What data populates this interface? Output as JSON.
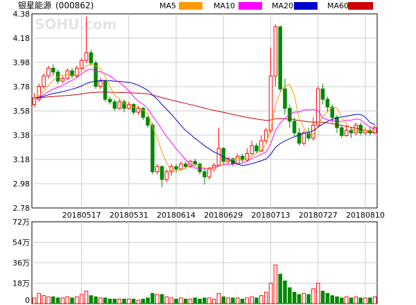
{
  "header": {
    "title": "银星能源",
    "code": "(000862)"
  },
  "legend": [
    {
      "label": "MA5",
      "color": "#ff9900"
    },
    {
      "label": "MA10",
      "color": "#ff00ff"
    },
    {
      "label": "MA20",
      "color": "#0000cc"
    },
    {
      "label": "MA60",
      "color": "#cc0000"
    }
  ],
  "watermark": "SOHU.com",
  "colors": {
    "up": "#ff0000",
    "down": "#008800",
    "grid": "#cccccc",
    "axis": "#000000",
    "text": "#000000"
  },
  "chart_data": [
    {
      "type": "candlestick",
      "title": "",
      "ylim": [
        2.78,
        4.28
      ],
      "y_ticks": [
        "4.38",
        "4.18",
        "3.98",
        "3.78",
        "3.58",
        "3.38",
        "3.18",
        "2.98",
        "2.78"
      ],
      "x_ticks": [
        {
          "label": "20180517",
          "index": 10
        },
        {
          "label": "20180531",
          "index": 20
        },
        {
          "label": "20180614",
          "index": 30
        },
        {
          "label": "20180629",
          "index": 40
        },
        {
          "label": "20180713",
          "index": 50
        },
        {
          "label": "20180727",
          "index": 60
        },
        {
          "label": "20180810",
          "index": 70
        }
      ],
      "candles": [
        [
          3.58,
          3.63,
          3.67,
          3.56
        ],
        [
          3.62,
          3.72,
          3.74,
          3.6
        ],
        [
          3.72,
          3.8,
          3.82,
          3.7
        ],
        [
          3.8,
          3.86,
          3.88,
          3.78
        ],
        [
          3.86,
          3.83,
          3.89,
          3.8
        ],
        [
          3.83,
          3.76,
          3.85,
          3.74
        ],
        [
          3.76,
          3.78,
          3.8,
          3.74
        ],
        [
          3.78,
          3.84,
          3.86,
          3.77
        ],
        [
          3.84,
          3.8,
          3.86,
          3.78
        ],
        [
          3.8,
          3.86,
          3.88,
          3.79
        ],
        [
          3.86,
          3.92,
          3.94,
          3.85
        ],
        [
          3.92,
          3.98,
          4.26,
          3.9
        ],
        [
          3.98,
          3.9,
          4.0,
          3.88
        ],
        [
          3.9,
          3.72,
          3.92,
          3.7
        ],
        [
          3.72,
          3.76,
          3.79,
          3.7
        ],
        [
          3.76,
          3.62,
          3.77,
          3.6
        ],
        [
          3.62,
          3.6,
          3.64,
          3.58
        ],
        [
          3.6,
          3.55,
          3.62,
          3.53
        ],
        [
          3.55,
          3.6,
          3.62,
          3.54
        ],
        [
          3.6,
          3.55,
          3.62,
          3.52
        ],
        [
          3.55,
          3.58,
          3.6,
          3.54
        ],
        [
          3.58,
          3.52,
          3.59,
          3.5
        ],
        [
          3.52,
          3.55,
          3.57,
          3.5
        ],
        [
          3.55,
          3.48,
          3.56,
          3.46
        ],
        [
          3.48,
          3.42,
          3.49,
          3.4
        ],
        [
          3.42,
          3.06,
          3.44,
          3.04
        ],
        [
          3.06,
          3.1,
          3.12,
          3.04
        ],
        [
          3.1,
          3.0,
          3.11,
          2.94
        ],
        [
          3.0,
          3.06,
          3.08,
          2.98
        ],
        [
          3.06,
          3.1,
          3.12,
          3.03
        ],
        [
          3.1,
          3.08,
          3.12,
          3.05
        ],
        [
          3.08,
          3.12,
          3.14,
          3.07
        ],
        [
          3.12,
          3.1,
          3.14,
          3.08
        ],
        [
          3.1,
          3.14,
          3.15,
          3.09
        ],
        [
          3.14,
          3.12,
          3.16,
          3.1
        ],
        [
          3.12,
          3.06,
          3.13,
          3.04
        ],
        [
          3.06,
          3.02,
          3.08,
          2.96
        ],
        [
          3.02,
          3.08,
          3.1,
          3.0
        ],
        [
          3.08,
          3.11,
          3.13,
          3.06
        ],
        [
          3.11,
          3.24,
          3.4,
          3.1
        ],
        [
          3.24,
          3.14,
          3.25,
          3.12
        ],
        [
          3.14,
          3.16,
          3.18,
          3.12
        ],
        [
          3.16,
          3.12,
          3.17,
          3.1
        ],
        [
          3.12,
          3.18,
          3.2,
          3.11
        ],
        [
          3.18,
          3.15,
          3.2,
          3.13
        ],
        [
          3.15,
          3.2,
          3.24,
          3.14
        ],
        [
          3.2,
          3.26,
          3.3,
          3.19
        ],
        [
          3.26,
          3.22,
          3.28,
          3.2
        ],
        [
          3.22,
          3.3,
          3.34,
          3.21
        ],
        [
          3.3,
          3.38,
          3.4,
          3.28
        ],
        [
          3.38,
          3.8,
          4.02,
          3.36
        ],
        [
          3.8,
          4.18,
          4.2,
          3.72
        ],
        [
          4.18,
          3.7,
          4.19,
          3.68
        ],
        [
          3.7,
          3.55,
          3.78,
          3.5
        ],
        [
          3.55,
          3.45,
          3.58,
          3.4
        ],
        [
          3.45,
          3.36,
          3.48,
          3.33
        ],
        [
          3.36,
          3.28,
          3.4,
          3.26
        ],
        [
          3.28,
          3.36,
          3.38,
          3.26
        ],
        [
          3.36,
          3.32,
          3.4,
          3.3
        ],
        [
          3.32,
          3.42,
          3.48,
          3.3
        ],
        [
          3.42,
          3.7,
          3.72,
          3.4
        ],
        [
          3.7,
          3.62,
          3.74,
          3.58
        ],
        [
          3.62,
          3.56,
          3.64,
          3.52
        ],
        [
          3.56,
          3.48,
          3.58,
          3.44
        ],
        [
          3.48,
          3.4,
          3.5,
          3.36
        ],
        [
          3.4,
          3.34,
          3.42,
          3.32
        ],
        [
          3.34,
          3.38,
          3.42,
          3.33
        ],
        [
          3.38,
          3.36,
          3.4,
          3.32
        ],
        [
          3.36,
          3.42,
          3.44,
          3.34
        ],
        [
          3.42,
          3.36,
          3.44,
          3.34
        ],
        [
          3.36,
          3.38,
          3.4,
          3.34
        ],
        [
          3.38,
          3.36,
          3.4,
          3.34
        ],
        [
          3.36,
          3.4,
          3.42,
          3.35
        ]
      ]
    },
    {
      "type": "bar",
      "title": "",
      "ylim": [
        0,
        72
      ],
      "unit": "万",
      "y_ticks": [
        "72万",
        "54万",
        "36万",
        "18万",
        "0"
      ],
      "values": [
        5,
        9,
        7,
        6,
        6,
        5,
        5,
        6,
        5,
        6,
        8,
        11,
        7,
        6,
        5,
        5,
        4,
        4,
        4,
        4,
        4,
        4,
        3,
        4,
        5,
        9,
        8,
        8,
        6,
        5,
        4,
        5,
        4,
        4,
        5,
        4,
        5,
        5,
        4,
        9,
        6,
        5,
        5,
        5,
        4,
        5,
        6,
        5,
        7,
        10,
        18,
        34,
        26,
        20,
        14,
        10,
        8,
        9,
        8,
        13,
        18,
        11,
        9,
        7,
        6,
        5,
        6,
        5,
        6,
        5,
        5,
        5,
        6
      ]
    }
  ]
}
